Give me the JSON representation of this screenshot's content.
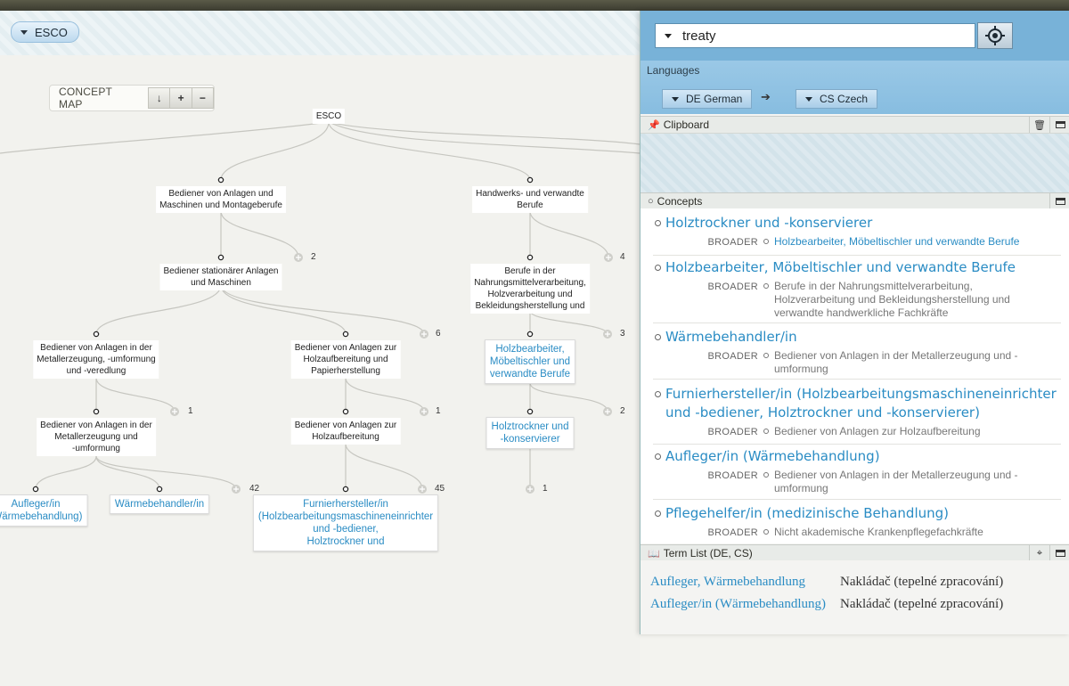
{
  "map": {
    "esco_label": "ESCO",
    "concept_map_label": "CONCEPT MAP",
    "tools": {
      "sort": "↓",
      "plus": "+",
      "minus": "−"
    },
    "nodes": {
      "root": "ESCO",
      "n1": "Bediener von Anlagen und\nMaschinen und Montageberufe",
      "n2": "Handwerks- und verwandte\nBerufe",
      "n3": "Bediener stationärer Anlagen\nund Maschinen",
      "n4": "Berufe in der\nNahrungsmittelverarbeitung,\nHolzverarbeitung und\nBekleidungsherstellung und",
      "n5": "Bediener von Anlagen in der\nMetallerzeugung, -umformung\nund -veredlung",
      "n6": "Bediener von Anlagen zur\nHolzaufbereitung und\nPapierherstellung",
      "n7": "Holzbearbeiter,\nMöbeltischler und\nverwandte Berufe",
      "n8": "Bediener von Anlagen in der\nMetallerzeugung und\n-umformung",
      "n9": "Bediener von Anlagen zur\nHolzaufbereitung",
      "n10": "Holztrockner und\n-konservierer",
      "n11": "Aufleger/in\n(Wärmebehandlung)",
      "n12": "Wärmebehandler/in",
      "n13": "Furnierhersteller/in\n(Holzbearbeitungsmaschineneinrichter\nund -bediener,\nHolztrockner und"
    },
    "counts": {
      "c1": "2",
      "c2": "4",
      "c3": "6",
      "c4": "3",
      "c5": "1",
      "c6": "1",
      "c7": "2",
      "c8": "42",
      "c9": "45",
      "c10": "1"
    }
  },
  "panel": {
    "search": {
      "value": "treaty"
    },
    "languages": {
      "title": "Languages",
      "source": "DE German",
      "target": "CS Czech",
      "arrow": "➔"
    },
    "clipboard": {
      "title": "Clipboard"
    },
    "concepts": {
      "title": "Concepts",
      "broader_label": "BROADER",
      "items": [
        {
          "title": "Holztrockner und -konservierer",
          "broader": "Holzbearbeiter, Möbeltischler und verwandte Berufe",
          "link": true
        },
        {
          "title": "Holzbearbeiter, Möbeltischler und verwandte Berufe",
          "broader": "Berufe in der Nahrungsmittelverarbeitung, Holzverarbeitung und Bekleidungsherstellung und verwandte handwerkliche Fachkräfte",
          "link": false
        },
        {
          "title": "Wärmebehandler/in",
          "broader": "Bediener von Anlagen in der Metallerzeugung und -umformung",
          "link": false
        },
        {
          "title": "Furnierhersteller/in (Holzbearbeitungsmaschineneinrichter und -bediener, Holztrockner und -konservierer)",
          "broader": "Bediener von Anlagen zur Holzaufbereitung",
          "link": false
        },
        {
          "title": "Aufleger/in (Wärmebehandlung)",
          "broader": "Bediener von Anlagen in der Metallerzeugung und -umformung",
          "link": false
        },
        {
          "title": "Pflegehelfer/in (medizinische Behandlung)",
          "broader": "Nicht akademische Krankenpflegefachkräfte",
          "link": false
        }
      ]
    },
    "termlist": {
      "title": "Term List (DE, CS)",
      "rows": [
        {
          "de": "Aufleger, Wärmebehandlung",
          "cs": "Nakládač (tepelné zpracování)"
        },
        {
          "de": "Aufleger/in (Wärmebehandlung)",
          "cs": "Nakládač (tepelné zpracování)"
        }
      ]
    }
  }
}
